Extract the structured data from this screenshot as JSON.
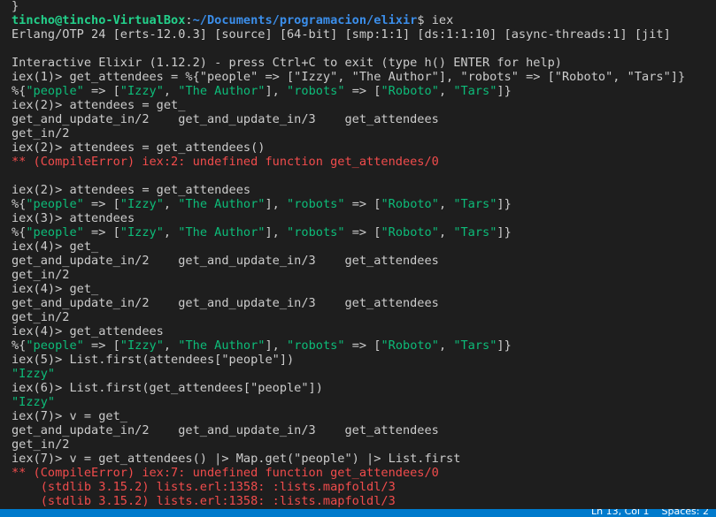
{
  "colors": {
    "default": "#cccccc",
    "user": "#23d18b",
    "path": "#3b8eea",
    "string": "#0dbc79",
    "error": "#f14c4c",
    "statusbar": "#007acc"
  },
  "terminal": {
    "lines": [
      [
        {
          "t": "}",
          "c": "default"
        }
      ],
      [
        {
          "t": "tincho@tincho-VirtualBox",
          "c": "user",
          "b": true
        },
        {
          "t": ":",
          "c": "default"
        },
        {
          "t": "~/Documents/programacion/elixir",
          "c": "path",
          "b": true
        },
        {
          "t": "$ iex",
          "c": "default"
        }
      ],
      [
        {
          "t": "Erlang/OTP 24 [erts-12.0.3] [source] [64-bit] [smp:1:1] [ds:1:1:10] [async-threads:1] [jit]",
          "c": "default"
        }
      ],
      [
        {
          "t": "",
          "c": "default"
        }
      ],
      [
        {
          "t": "Interactive Elixir (1.12.2) - press Ctrl+C to exit (type h() ENTER for help)",
          "c": "default"
        }
      ],
      [
        {
          "t": "iex(1)> get_attendees = %{\"people\" => [\"Izzy\", \"The Author\"], \"robots\" => [\"Roboto\", \"Tars\"]}",
          "c": "default"
        }
      ],
      [
        {
          "t": "%{",
          "c": "default"
        },
        {
          "t": "\"people\"",
          "c": "string"
        },
        {
          "t": " => [",
          "c": "default"
        },
        {
          "t": "\"Izzy\"",
          "c": "string"
        },
        {
          "t": ", ",
          "c": "default"
        },
        {
          "t": "\"The Author\"",
          "c": "string"
        },
        {
          "t": "], ",
          "c": "default"
        },
        {
          "t": "\"robots\"",
          "c": "string"
        },
        {
          "t": " => [",
          "c": "default"
        },
        {
          "t": "\"Roboto\"",
          "c": "string"
        },
        {
          "t": ", ",
          "c": "default"
        },
        {
          "t": "\"Tars\"",
          "c": "string"
        },
        {
          "t": "]}",
          "c": "default"
        }
      ],
      [
        {
          "t": "iex(2)> attendees = get_",
          "c": "default"
        }
      ],
      [
        {
          "t": "get_and_update_in/2    get_and_update_in/3    get_attendees",
          "c": "default"
        }
      ],
      [
        {
          "t": "get_in/2",
          "c": "default"
        }
      ],
      [
        {
          "t": "iex(2)> attendees = get_attendees()",
          "c": "default"
        }
      ],
      [
        {
          "t": "** (CompileError) iex:2: undefined function get_attendees/0",
          "c": "error"
        }
      ],
      [
        {
          "t": "",
          "c": "default"
        }
      ],
      [
        {
          "t": "iex(2)> attendees = get_attendees",
          "c": "default"
        }
      ],
      [
        {
          "t": "%{",
          "c": "default"
        },
        {
          "t": "\"people\"",
          "c": "string"
        },
        {
          "t": " => [",
          "c": "default"
        },
        {
          "t": "\"Izzy\"",
          "c": "string"
        },
        {
          "t": ", ",
          "c": "default"
        },
        {
          "t": "\"The Author\"",
          "c": "string"
        },
        {
          "t": "], ",
          "c": "default"
        },
        {
          "t": "\"robots\"",
          "c": "string"
        },
        {
          "t": " => [",
          "c": "default"
        },
        {
          "t": "\"Roboto\"",
          "c": "string"
        },
        {
          "t": ", ",
          "c": "default"
        },
        {
          "t": "\"Tars\"",
          "c": "string"
        },
        {
          "t": "]}",
          "c": "default"
        }
      ],
      [
        {
          "t": "iex(3)> attendees",
          "c": "default"
        }
      ],
      [
        {
          "t": "%{",
          "c": "default"
        },
        {
          "t": "\"people\"",
          "c": "string"
        },
        {
          "t": " => [",
          "c": "default"
        },
        {
          "t": "\"Izzy\"",
          "c": "string"
        },
        {
          "t": ", ",
          "c": "default"
        },
        {
          "t": "\"The Author\"",
          "c": "string"
        },
        {
          "t": "], ",
          "c": "default"
        },
        {
          "t": "\"robots\"",
          "c": "string"
        },
        {
          "t": " => [",
          "c": "default"
        },
        {
          "t": "\"Roboto\"",
          "c": "string"
        },
        {
          "t": ", ",
          "c": "default"
        },
        {
          "t": "\"Tars\"",
          "c": "string"
        },
        {
          "t": "]}",
          "c": "default"
        }
      ],
      [
        {
          "t": "iex(4)> get_",
          "c": "default"
        }
      ],
      [
        {
          "t": "get_and_update_in/2    get_and_update_in/3    get_attendees",
          "c": "default"
        }
      ],
      [
        {
          "t": "get_in/2",
          "c": "default"
        }
      ],
      [
        {
          "t": "iex(4)> get_",
          "c": "default"
        }
      ],
      [
        {
          "t": "get_and_update_in/2    get_and_update_in/3    get_attendees",
          "c": "default"
        }
      ],
      [
        {
          "t": "get_in/2",
          "c": "default"
        }
      ],
      [
        {
          "t": "iex(4)> get_attendees",
          "c": "default"
        }
      ],
      [
        {
          "t": "%{",
          "c": "default"
        },
        {
          "t": "\"people\"",
          "c": "string"
        },
        {
          "t": " => [",
          "c": "default"
        },
        {
          "t": "\"Izzy\"",
          "c": "string"
        },
        {
          "t": ", ",
          "c": "default"
        },
        {
          "t": "\"The Author\"",
          "c": "string"
        },
        {
          "t": "], ",
          "c": "default"
        },
        {
          "t": "\"robots\"",
          "c": "string"
        },
        {
          "t": " => [",
          "c": "default"
        },
        {
          "t": "\"Roboto\"",
          "c": "string"
        },
        {
          "t": ", ",
          "c": "default"
        },
        {
          "t": "\"Tars\"",
          "c": "string"
        },
        {
          "t": "]}",
          "c": "default"
        }
      ],
      [
        {
          "t": "iex(5)> List.first(attendees[\"people\"])",
          "c": "default"
        }
      ],
      [
        {
          "t": "\"Izzy\"",
          "c": "string"
        }
      ],
      [
        {
          "t": "iex(6)> List.first(get_attendees[\"people\"])",
          "c": "default"
        }
      ],
      [
        {
          "t": "\"Izzy\"",
          "c": "string"
        }
      ],
      [
        {
          "t": "iex(7)> v = get_",
          "c": "default"
        }
      ],
      [
        {
          "t": "get_and_update_in/2    get_and_update_in/3    get_attendees",
          "c": "default"
        }
      ],
      [
        {
          "t": "get_in/2",
          "c": "default"
        }
      ],
      [
        {
          "t": "iex(7)> v = get_attendees() |> Map.get(\"people\") |> List.first",
          "c": "default"
        }
      ],
      [
        {
          "t": "** (CompileError) iex:7: undefined function get_attendees/0",
          "c": "error"
        }
      ],
      [
        {
          "t": "    (stdlib 3.15.2) lists.erl:1358: :lists.mapfoldl/3",
          "c": "error"
        }
      ],
      [
        {
          "t": "    (stdlib 3.15.2) lists.erl:1358: :lists.mapfoldl/3",
          "c": "error"
        }
      ]
    ]
  },
  "statusbar": {
    "text": "Ln 13, Col 1    Spaces: 2"
  }
}
